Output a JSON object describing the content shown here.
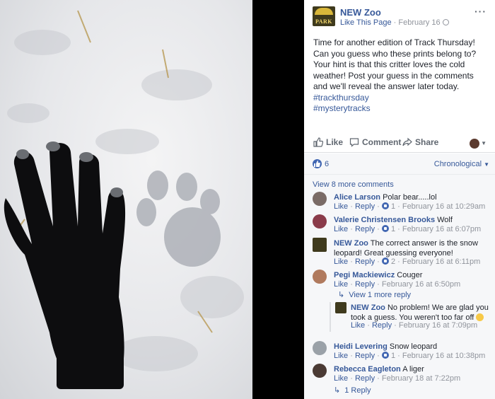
{
  "post": {
    "page_name": "NEW Zoo",
    "page_logo_text": "PARK",
    "like_page": "Like This Page",
    "separator": " · ",
    "date": "February 16",
    "text": "Time for another edition of Track Thursday! Can you guess who these prints belong to? Your hint is that this critter loves the cold weather! Post your guess in the comments and we'll reveal the answer later today. ",
    "hashtag_1": "#trackthursday",
    "hashtag_2": "#mysterytracks"
  },
  "actions": {
    "like": "Like",
    "comment": "Comment",
    "share": "Share"
  },
  "reactions": {
    "count": "6",
    "order": "Chronological"
  },
  "comments": {
    "view_more": "View 8 more comments",
    "items": [
      {
        "author": "Alice Larson",
        "text": "Polar bear.....lol",
        "like": "Like",
        "reply": "Reply",
        "likes": "1",
        "time": "February 16 at 10:29am"
      },
      {
        "author": "Valerie Christensen Brooks",
        "text": "Wolf",
        "like": "Like",
        "reply": "Reply",
        "likes": "1",
        "time": "February 16 at 6:07pm"
      },
      {
        "author": "NEW Zoo",
        "text": "The correct answer is the snow leopard! Great guessing everyone!",
        "like": "Like",
        "reply": "Reply",
        "likes": "2",
        "time": "February 16 at 6:11pm"
      },
      {
        "author": "Pegi Mackiewicz",
        "text": "Couger",
        "like": "Like",
        "reply": "Reply",
        "time": "February 16 at 6:50pm",
        "view_replies": "View 1 more reply"
      },
      {
        "author": "NEW Zoo",
        "text": "No problem! We are glad you took a guess. You weren't too far off",
        "like": "Like",
        "reply": "Reply",
        "time": "February 16 at 7:09pm"
      },
      {
        "author": "Heidi Levering",
        "text": "Snow leopard",
        "like": "Like",
        "reply": "Reply",
        "likes": "1",
        "time": "February 16 at 10:38pm"
      },
      {
        "author": "Rebecca Eagleton",
        "text": "A liger",
        "like": "Like",
        "reply": "Reply",
        "time": "February 18 at 7:22pm",
        "replies": "1 Reply"
      }
    ]
  },
  "colors": {
    "link": "#365899",
    "muted": "#90949c",
    "like_blue": "#4267b2",
    "panel_bg": "#f6f7f9"
  },
  "icons": [
    "like-thumb-icon",
    "comment-bubble-icon",
    "share-arrow-icon",
    "globe-icon",
    "more-options-icon",
    "reply-arrow-icon",
    "smiley-emoji-icon"
  ]
}
